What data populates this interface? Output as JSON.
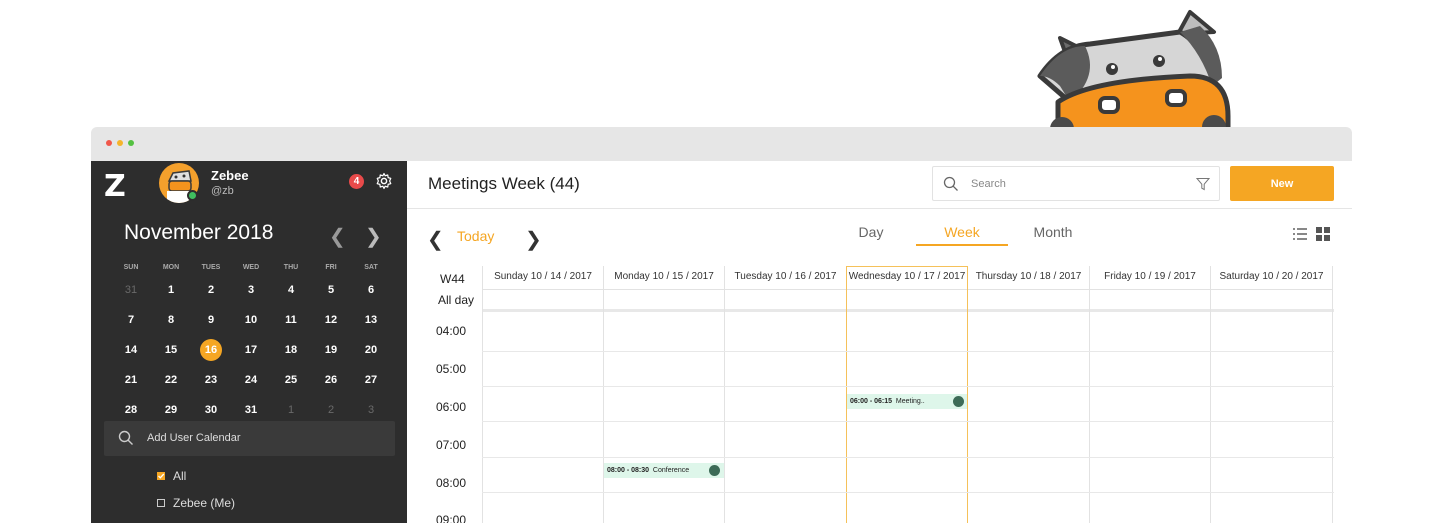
{
  "app": {
    "logo": "Z",
    "user_name": "Zebee",
    "user_handle": "@zb",
    "notifications": "4"
  },
  "mini_calendar": {
    "month_title": "November 2018",
    "weekdays": [
      "SUN",
      "MON",
      "TUES",
      "WED",
      "THU",
      "FRI",
      "SAT"
    ],
    "weeks": [
      [
        "31",
        "1",
        "2",
        "3",
        "4",
        "5",
        "6"
      ],
      [
        "7",
        "8",
        "9",
        "10",
        "11",
        "12",
        "13"
      ],
      [
        "14",
        "15",
        "16",
        "17",
        "18",
        "19",
        "20"
      ],
      [
        "21",
        "22",
        "23",
        "24",
        "25",
        "26",
        "27"
      ],
      [
        "28",
        "29",
        "30",
        "31",
        "1",
        "2",
        "3"
      ]
    ],
    "today": "16"
  },
  "sidebar": {
    "add_calendar_placeholder": "Add User Calendar",
    "calendars": [
      {
        "label": "All",
        "checked": true
      },
      {
        "label": "Zebee (Me)",
        "checked": false
      }
    ]
  },
  "header": {
    "title": "Meetings Week (44)",
    "search_placeholder": "Search",
    "new_button": "New"
  },
  "nav": {
    "today": "Today",
    "views": [
      "Day",
      "Week",
      "Month"
    ],
    "active_view": "Week"
  },
  "week": {
    "week_label": "W44",
    "all_day_label": "All day",
    "days": [
      "Sunday 10 / 14 / 2017",
      "Monday 10 / 15 / 2017",
      "Tuesday 10 / 16 / 2017",
      "Wednesday 10 / 17 / 2017",
      "Thursday 10 / 18 / 2017",
      "Friday 10 / 19 / 2017",
      "Saturday 10 / 20 / 2017"
    ],
    "highlighted_day": "Wednesday 10 / 17 / 2017",
    "times": [
      "04:00",
      "05:00",
      "06:00",
      "07:00",
      "08:00",
      "09:00"
    ],
    "events": [
      {
        "time": "06:00 - 06:15",
        "title": "Meeting..",
        "day": "Wednesday 10 / 17 / 2017"
      },
      {
        "time": "08:00 - 08:30",
        "title": "Conference",
        "day": "Monday 10 / 15 / 2017"
      }
    ]
  },
  "colors": {
    "accent": "#f5a623",
    "sidebar_bg": "#2d2d2d",
    "event_bg": "#def6ea",
    "badge": "#e84a4a"
  }
}
